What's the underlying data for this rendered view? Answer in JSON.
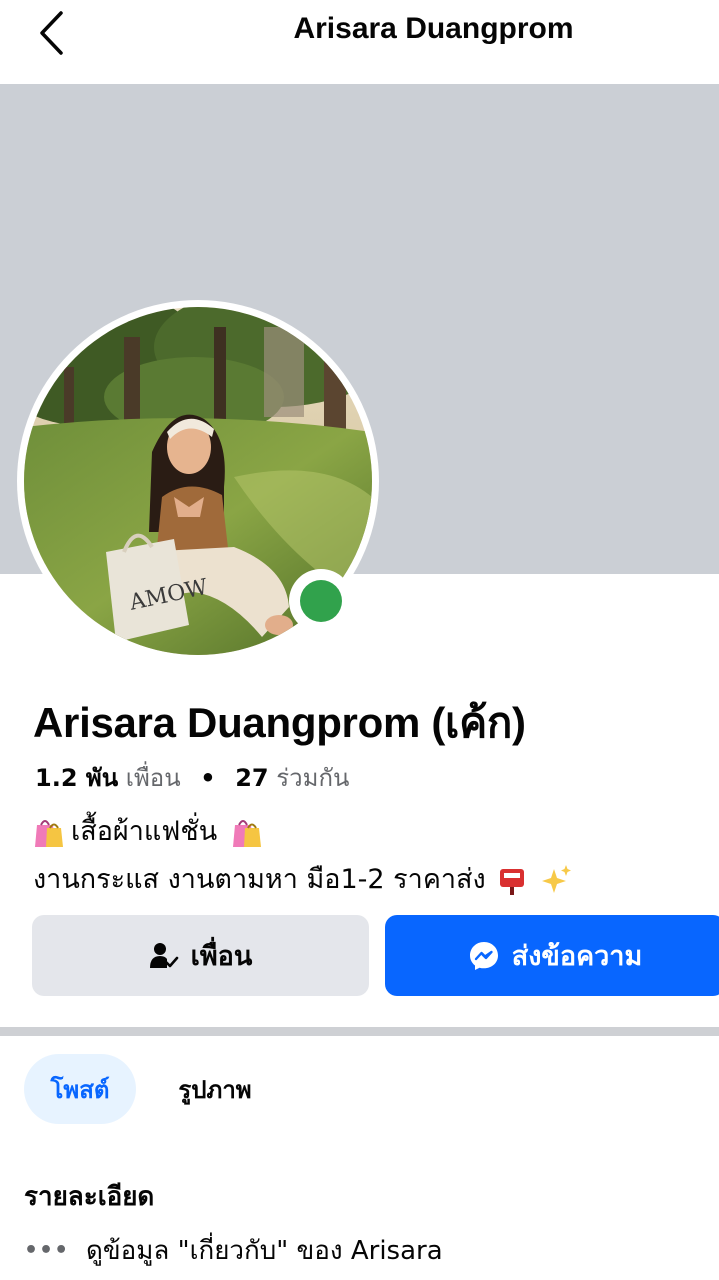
{
  "header": {
    "title": "Arisara Duangprom",
    "back_icon": "chevron-left-icon"
  },
  "profile": {
    "name": "Arisara Duangprom (เค้ก)",
    "friends_count": "1.2 พัน",
    "friends_label": "เพื่อน",
    "separator": "•",
    "mutual_count": "27",
    "mutual_label": "ร่วมกัน",
    "bio_line1": "เสื้อผ้าแฟชั่น",
    "bio_line2": "งานกระแส งานตามหา มือ1-2 ราคาส่ง",
    "online": true,
    "online_color": "#31a24c"
  },
  "buttons": {
    "friend_label": "เพื่อน",
    "message_label": "ส่งข้อความ"
  },
  "tabs": [
    {
      "label": "โพสต์",
      "active": true
    },
    {
      "label": "รูปภาพ",
      "active": false
    }
  ],
  "details": {
    "title": "รายละเอียด",
    "more_icon": "•••",
    "about_link": "ดูข้อมูล \"เกี่ยวกับ\" ของ Arisara"
  },
  "colors": {
    "accent": "#0866ff",
    "cover": "#cbcfd5",
    "button_gray": "#e4e6eb",
    "tab_active_bg": "#e7f3ff"
  }
}
